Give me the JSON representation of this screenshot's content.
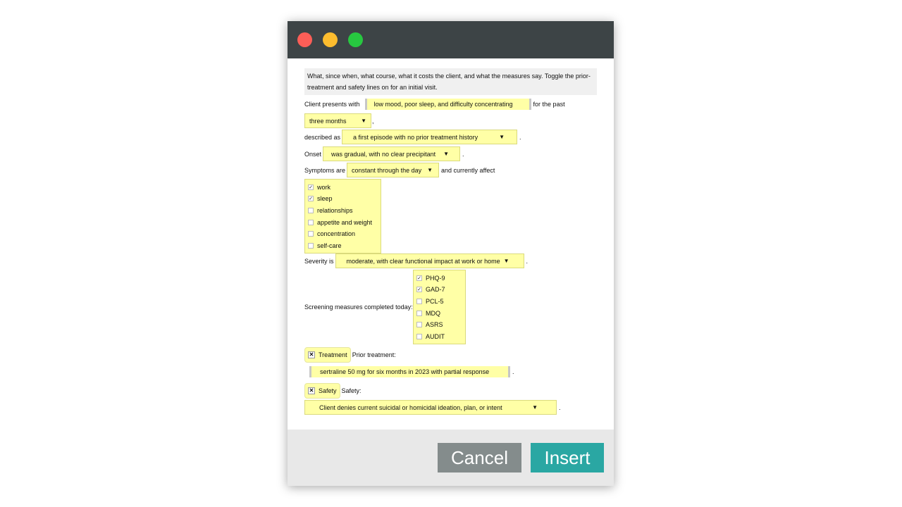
{
  "help_text": "What, since when, what course, what it costs the client, and what the measures say. Toggle the prior-treatment and safety lines on for an initial visit.",
  "presentation": {
    "prefix": "Client presents with",
    "complaint": "low mood, poor sleep, and difficulty concentrating",
    "suffix": "for the past",
    "duration": "three months",
    "duration_suffix": ","
  },
  "description": {
    "prefix": "described as",
    "value": "a first episode with no prior treatment history",
    "suffix": "."
  },
  "onset": {
    "prefix": "Onset",
    "value": "was gradual, with no clear precipitant",
    "suffix": "."
  },
  "symptoms": {
    "prefix": "Symptoms are",
    "value": "constant through the day",
    "suffix": "and currently affect",
    "affects": [
      {
        "label": "work",
        "checked": true
      },
      {
        "label": "sleep",
        "checked": true
      },
      {
        "label": "relationships",
        "checked": false
      },
      {
        "label": "appetite and weight",
        "checked": false
      },
      {
        "label": "concentration",
        "checked": false
      },
      {
        "label": "self-care",
        "checked": false
      }
    ]
  },
  "severity": {
    "prefix": "Severity is",
    "value": "moderate, with clear functional impact at work or home",
    "suffix": "."
  },
  "screening": {
    "prefix": "Screening measures completed today:",
    "measures": [
      {
        "label": "PHQ-9",
        "checked": true
      },
      {
        "label": "GAD-7",
        "checked": true
      },
      {
        "label": "PCL-5",
        "checked": false
      },
      {
        "label": "MDQ",
        "checked": false
      },
      {
        "label": "ASRS",
        "checked": false
      },
      {
        "label": "AUDIT",
        "checked": false
      }
    ]
  },
  "treatment": {
    "toggle_label": "Treatment",
    "toggle_mark": "✕",
    "heading": "Prior treatment:",
    "value": "sertraline 50 mg for six months in 2023 with partial response",
    "suffix": "."
  },
  "safety": {
    "toggle_label": "Safety",
    "toggle_mark": "✕",
    "heading": "Safety:",
    "value": "Client denies current suicidal or homicidal ideation, plan, or intent",
    "suffix": "."
  },
  "icons": {
    "dropdown": "▼",
    "check": "✓"
  },
  "buttons": {
    "cancel": "Cancel",
    "insert": "Insert"
  },
  "colors": {
    "field": "#ffffa6",
    "titlebar": "#3d4446",
    "insert": "#2aa7a3",
    "cancel": "#848c8c"
  }
}
